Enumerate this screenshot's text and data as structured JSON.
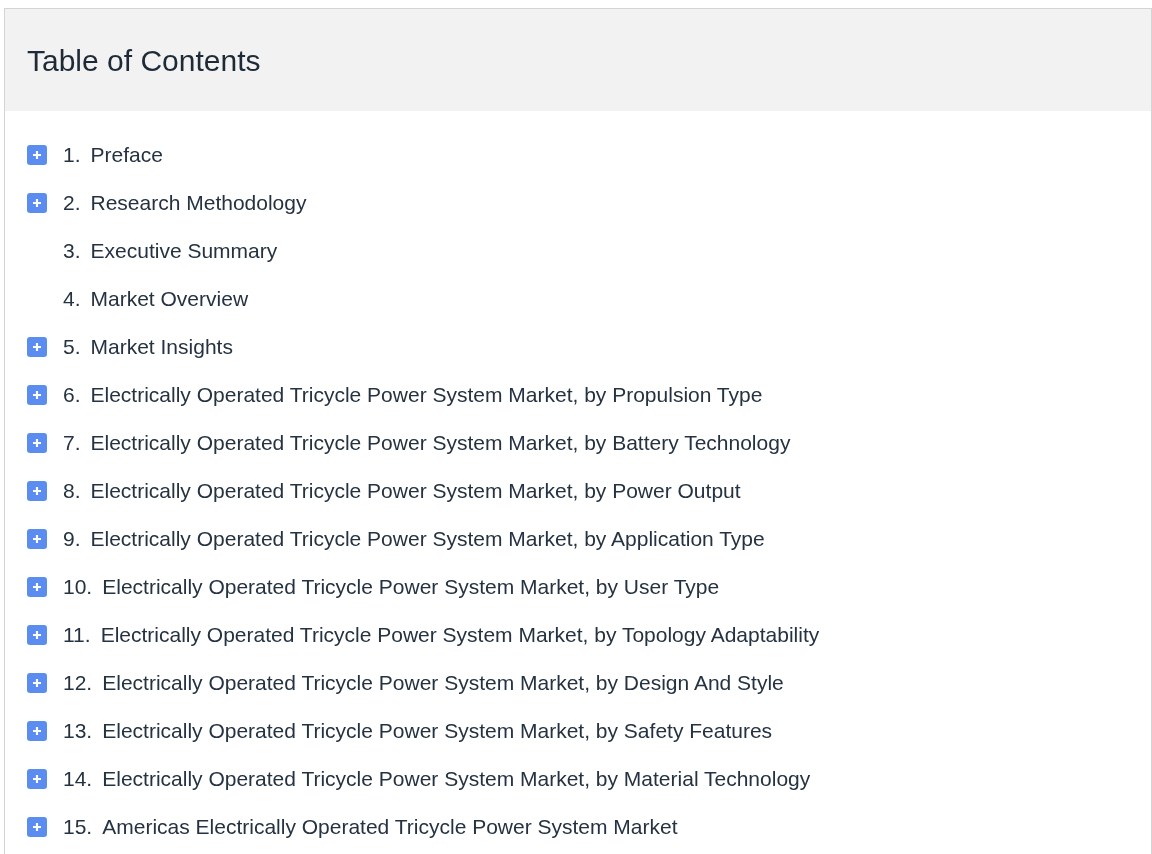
{
  "title": "Table of Contents",
  "items": [
    {
      "kind": "expandable",
      "number": "1.",
      "label": "Preface"
    },
    {
      "kind": "expandable",
      "number": "2.",
      "label": "Research Methodology"
    },
    {
      "kind": "leaf",
      "number": "3.",
      "label": "Executive Summary"
    },
    {
      "kind": "leaf",
      "number": "4.",
      "label": "Market Overview"
    },
    {
      "kind": "expandable",
      "number": "5.",
      "label": "Market Insights"
    },
    {
      "kind": "expandable",
      "number": "6.",
      "label": "Electrically Operated Tricycle Power System Market, by Propulsion Type"
    },
    {
      "kind": "expandable",
      "number": "7.",
      "label": "Electrically Operated Tricycle Power System Market, by Battery Technology"
    },
    {
      "kind": "expandable",
      "number": "8.",
      "label": "Electrically Operated Tricycle Power System Market, by Power Output"
    },
    {
      "kind": "expandable",
      "number": "9.",
      "label": "Electrically Operated Tricycle Power System Market, by Application Type"
    },
    {
      "kind": "expandable",
      "number": "10.",
      "label": "Electrically Operated Tricycle Power System Market, by User Type"
    },
    {
      "kind": "expandable",
      "number": "11.",
      "label": "Electrically Operated Tricycle Power System Market, by Topology Adaptability"
    },
    {
      "kind": "expandable",
      "number": "12.",
      "label": "Electrically Operated Tricycle Power System Market, by Design And Style"
    },
    {
      "kind": "expandable",
      "number": "13.",
      "label": "Electrically Operated Tricycle Power System Market, by Safety Features"
    },
    {
      "kind": "expandable",
      "number": "14.",
      "label": "Electrically Operated Tricycle Power System Market, by Material Technology"
    },
    {
      "kind": "expandable",
      "number": "15.",
      "label": "Americas Electrically Operated Tricycle Power System Market"
    }
  ]
}
